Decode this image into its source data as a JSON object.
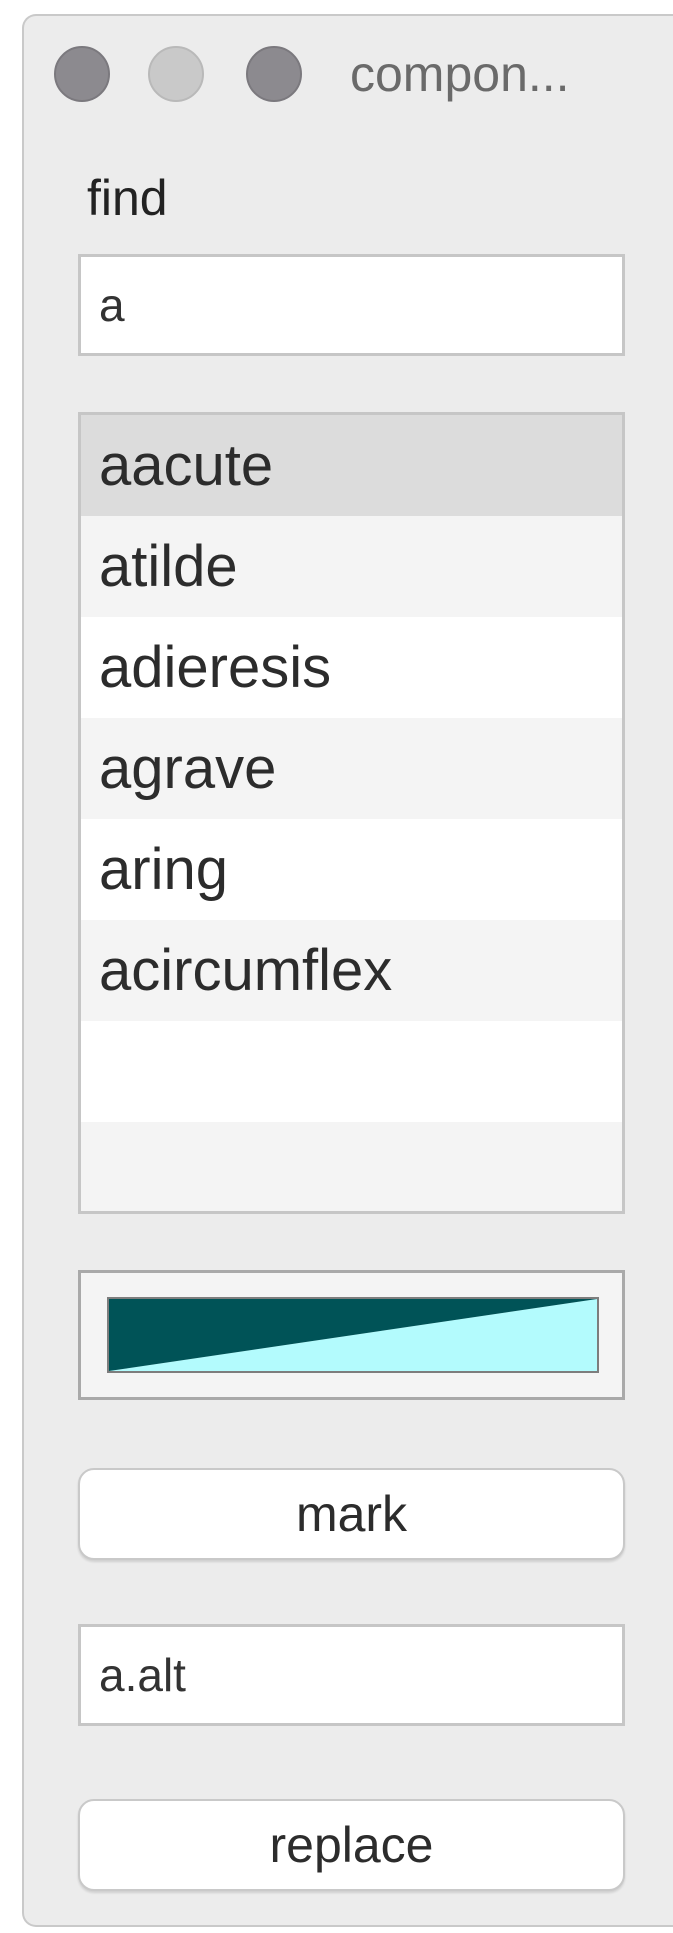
{
  "window": {
    "title": "compon..."
  },
  "find": {
    "label": "find",
    "value": "a"
  },
  "glyph_list": {
    "items": [
      "aacute",
      "atilde",
      "adieresis",
      "agrave",
      "aring",
      "acircumflex",
      "",
      ""
    ],
    "selected_index": 0
  },
  "color_well": {
    "dark_color": "#005357",
    "light_color": "#b3fbfd"
  },
  "mark_button": {
    "label": "mark"
  },
  "replace": {
    "value": "a.alt",
    "button_label": "replace"
  }
}
